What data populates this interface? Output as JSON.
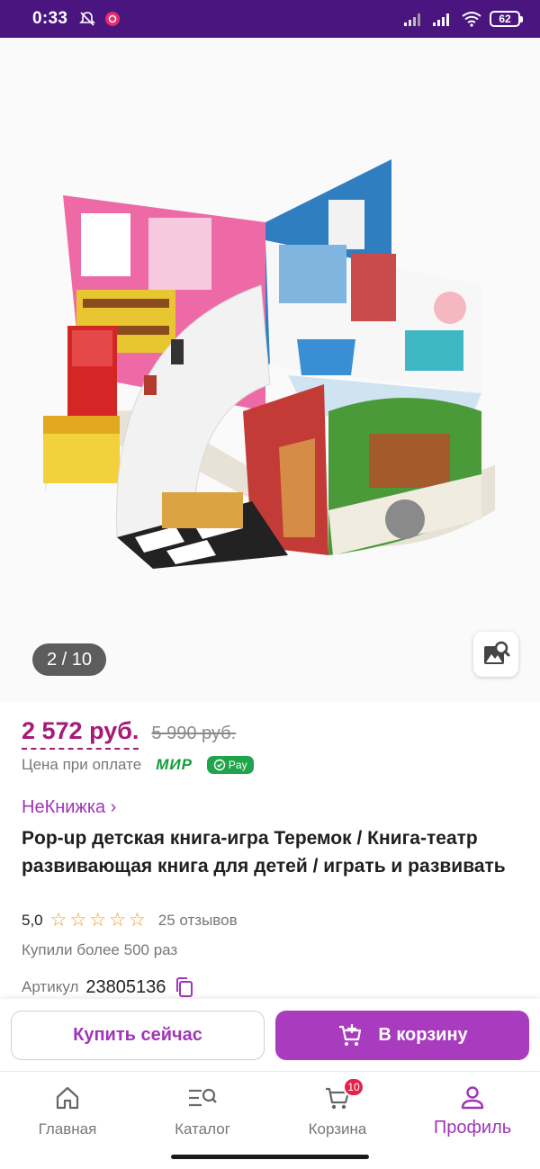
{
  "status_bar": {
    "time": "0:33",
    "battery": "62",
    "icons": [
      "mute-icon",
      "notification-icon",
      "signal-icon",
      "signal-icon",
      "wifi-icon",
      "battery-icon"
    ]
  },
  "gallery": {
    "counter": "2 / 10",
    "image_search_icon": "image-search-icon"
  },
  "product": {
    "price": "2 572 руб.",
    "old_price": "5 990 руб.",
    "pay_label": "Цена при оплате",
    "mir": "МИР",
    "pay_badge": "Pay",
    "brand": "НеКнижка ›",
    "title": "Pop-up детская книга-игра Теремок / Книга-театр развивающая книга для детей / играть и развивать",
    "rating": "5,0",
    "stars": 5,
    "reviews": "25 отзывов",
    "purchased": "Купили более 500 раз",
    "article_label": "Артикул",
    "article": "23805136"
  },
  "actions": {
    "buy_now": "Купить сейчас",
    "add_to_cart": "В корзину"
  },
  "nav": {
    "items": [
      {
        "label": "Главная",
        "icon": "home-icon"
      },
      {
        "label": "Каталог",
        "icon": "catalog-search-icon"
      },
      {
        "label": "Корзина",
        "icon": "cart-icon",
        "badge": "10"
      },
      {
        "label": "Профиль",
        "icon": "profile-icon"
      }
    ],
    "active": "Профиль"
  },
  "colors": {
    "status_bar": "#4b1580",
    "accent": "#a035b8",
    "price": "#a41b78",
    "cart_button": "#a93bbf",
    "star": "#f39a1b",
    "badge": "#e5234a"
  }
}
